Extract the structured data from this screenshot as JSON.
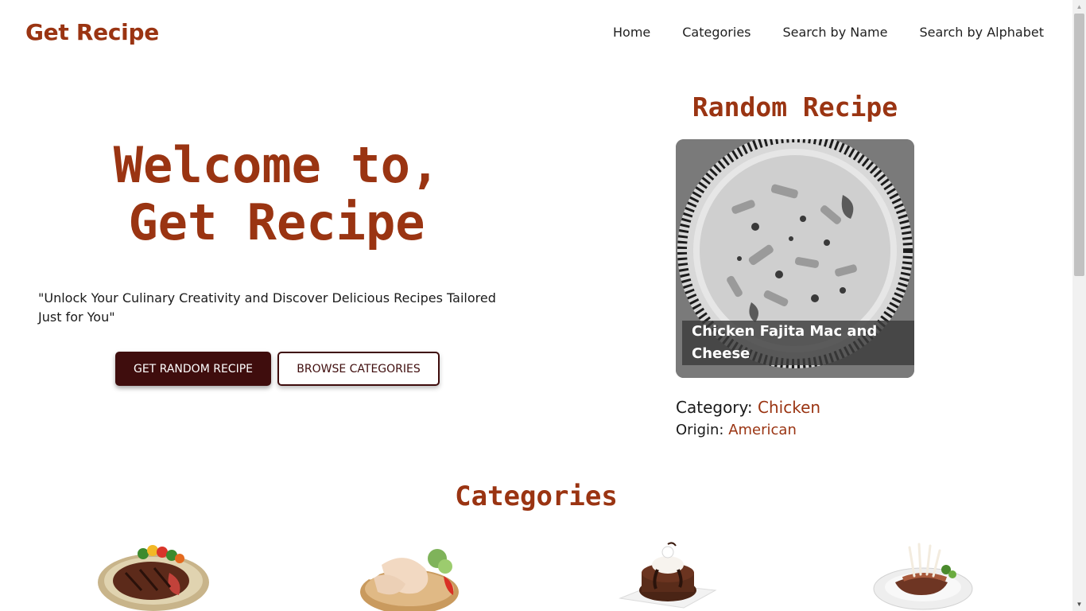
{
  "brand": {
    "name": "Get Recipe"
  },
  "nav": {
    "items": [
      "Home",
      "Categories",
      "Search by Name",
      "Search by Alphabet"
    ]
  },
  "hero": {
    "title_line1": "Welcome to,",
    "title_line2": "Get Recipe",
    "tagline": "\"Unlock Your Culinary Creativity and Discover Delicious Recipes Tailored Just for You\"",
    "primary_button": "GET RANDOM RECIPE",
    "secondary_button": "BROWSE CATEGORIES"
  },
  "random_recipe": {
    "heading": "Random Recipe",
    "name": "Chicken Fajita Mac and Cheese",
    "category_label": "Category:",
    "category_value": "Chicken",
    "origin_label": "Origin:",
    "origin_value": "American"
  },
  "categories": {
    "heading": "Categories",
    "thumbnails": [
      "beef-plate-image",
      "chicken-plate-image",
      "dessert-plate-image",
      "lamb-plate-image"
    ]
  },
  "colors": {
    "accent": "#9a3412",
    "button_dark": "#3f0d0d"
  }
}
